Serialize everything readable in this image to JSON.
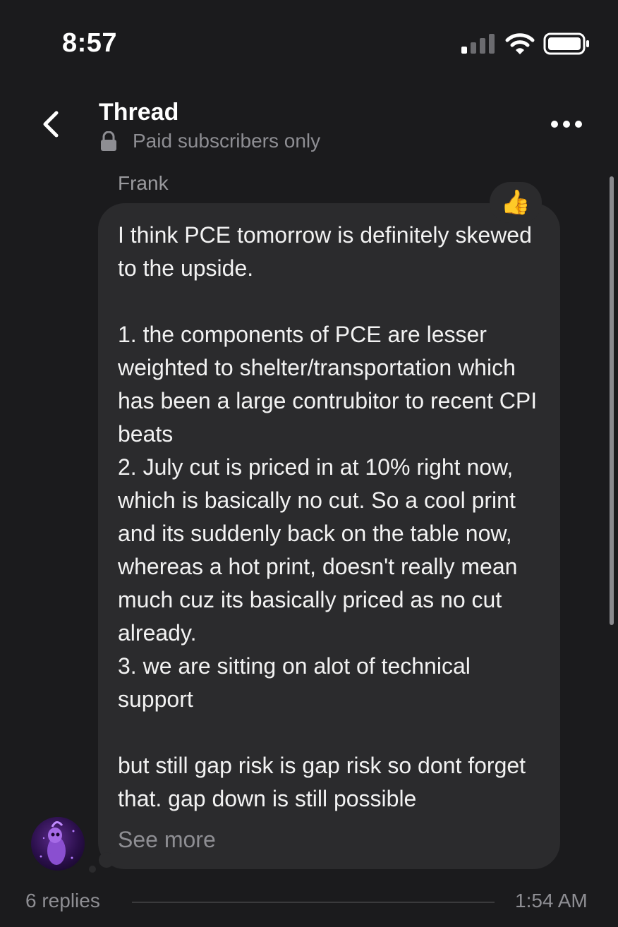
{
  "status_bar": {
    "time": "8:57"
  },
  "header": {
    "title": "Thread",
    "subtitle": "Paid subscribers only"
  },
  "message": {
    "author": "Frank",
    "reaction": "👍",
    "text": "I think PCE tomorrow is definitely skewed to the upside.\n\n1. the components of PCE are lesser weighted to shelter/transportation which has been a large contrubitor to recent CPI beats\n2. July cut is priced in at 10% right now, which is basically no cut. So a cool print and its suddenly back on the table now, whereas a hot print, doesn't really mean much cuz its basically priced as no cut already.\n3. we are sitting on alot of technical support\n\nbut still gap risk is gap risk so dont forget that. gap down is still possible",
    "see_more": "See more"
  },
  "footer": {
    "replies": "6 replies",
    "timestamp": "1:54 AM"
  }
}
